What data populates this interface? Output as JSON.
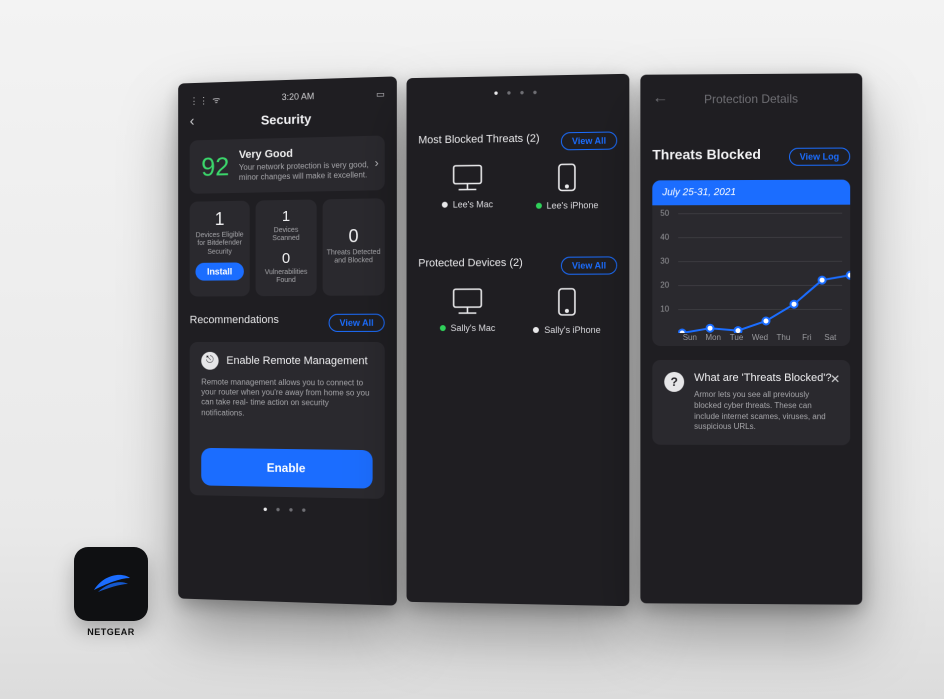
{
  "statusbar": {
    "time": "3:20 AM"
  },
  "screen1": {
    "title": "Security",
    "score": {
      "value": "92",
      "headline": "Very Good",
      "sub": "Your network protection is very good, minor changes will make it excellent."
    },
    "tile1": {
      "n": "1",
      "l": "Devices Eligible for Bitdefender Security",
      "btn": "Install"
    },
    "tile2a": {
      "n": "1",
      "l": "Devices Scanned"
    },
    "tile2b": {
      "n": "0",
      "l": "Vulnerabilities Found"
    },
    "tile3": {
      "n": "0",
      "l": "Threats Detected and Blocked"
    },
    "reco_section": "Recommendations",
    "view_all": "View All",
    "reco": {
      "title": "Enable Remote Management",
      "body": "Remote management allows you to connect to your router when you're away from home so you can take real- time action on security notifications.",
      "btn": "Enable"
    }
  },
  "screen2": {
    "sect1": "Most Blocked Threats (2)",
    "sect2": "Protected Devices (2)",
    "view_all": "View All",
    "d1": "Lee's Mac",
    "d2": "Lee's iPhone",
    "d3": "Sally's Mac",
    "d4": "Sally's iPhone"
  },
  "screen3": {
    "title": "Protection Details",
    "section": "Threats Blocked",
    "view_log": "View Log",
    "date_range": "July 25-31, 2021",
    "info": {
      "h": "What are 'Threats Blocked'?",
      "b": "Armor lets you see all previously blocked cyber threats. These can include internet scames, viruses, and suspicious URLs."
    }
  },
  "brand": "NETGEAR",
  "chart_data": {
    "type": "line",
    "title": "Threats Blocked",
    "xlabel": "",
    "ylabel": "",
    "ylim": [
      0,
      50
    ],
    "yticks": [
      10,
      20,
      30,
      40,
      50
    ],
    "categories": [
      "Sun",
      "Mon",
      "Tue",
      "Wed",
      "Thu",
      "Fri",
      "Sat"
    ],
    "values": [
      0,
      2,
      1,
      5,
      12,
      22,
      24
    ]
  }
}
